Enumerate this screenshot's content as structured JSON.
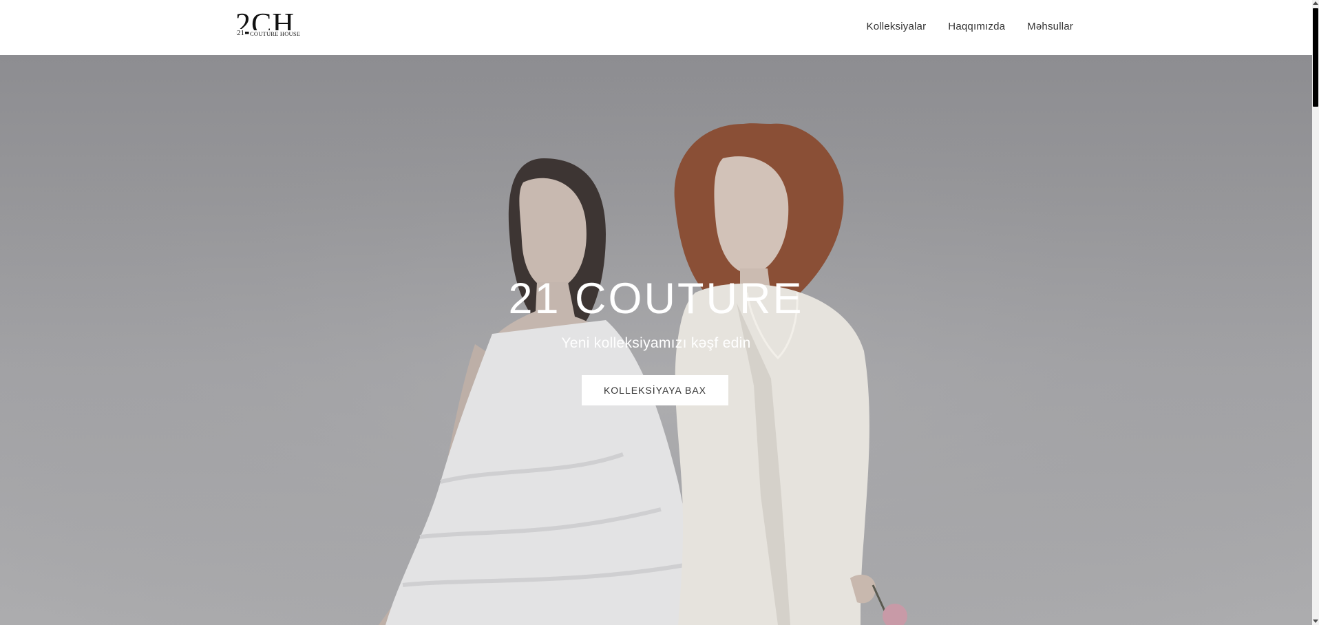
{
  "header": {
    "logo": {
      "letters": "2CH",
      "number": "21",
      "subtitle": "COUTURE HOUSE"
    },
    "nav": [
      {
        "label": "Kolleksiyalar"
      },
      {
        "label": "Haqqımızda"
      },
      {
        "label": "Məhsullar"
      }
    ]
  },
  "hero": {
    "title": "21 COUTURE",
    "subtitle": "Yeni kolleksiyamızı kəşf edin",
    "cta_label": "KOLLEKSİYAYA BAX",
    "image": "two-models-in-white-outfits"
  },
  "colors": {
    "header_bg": "#ffffff",
    "nav_text": "#333333",
    "hero_overlay": "#8f8f93",
    "hero_text": "#ffffff",
    "button_bg": "#ffffff",
    "scrollbar_thumb": "#000000"
  }
}
